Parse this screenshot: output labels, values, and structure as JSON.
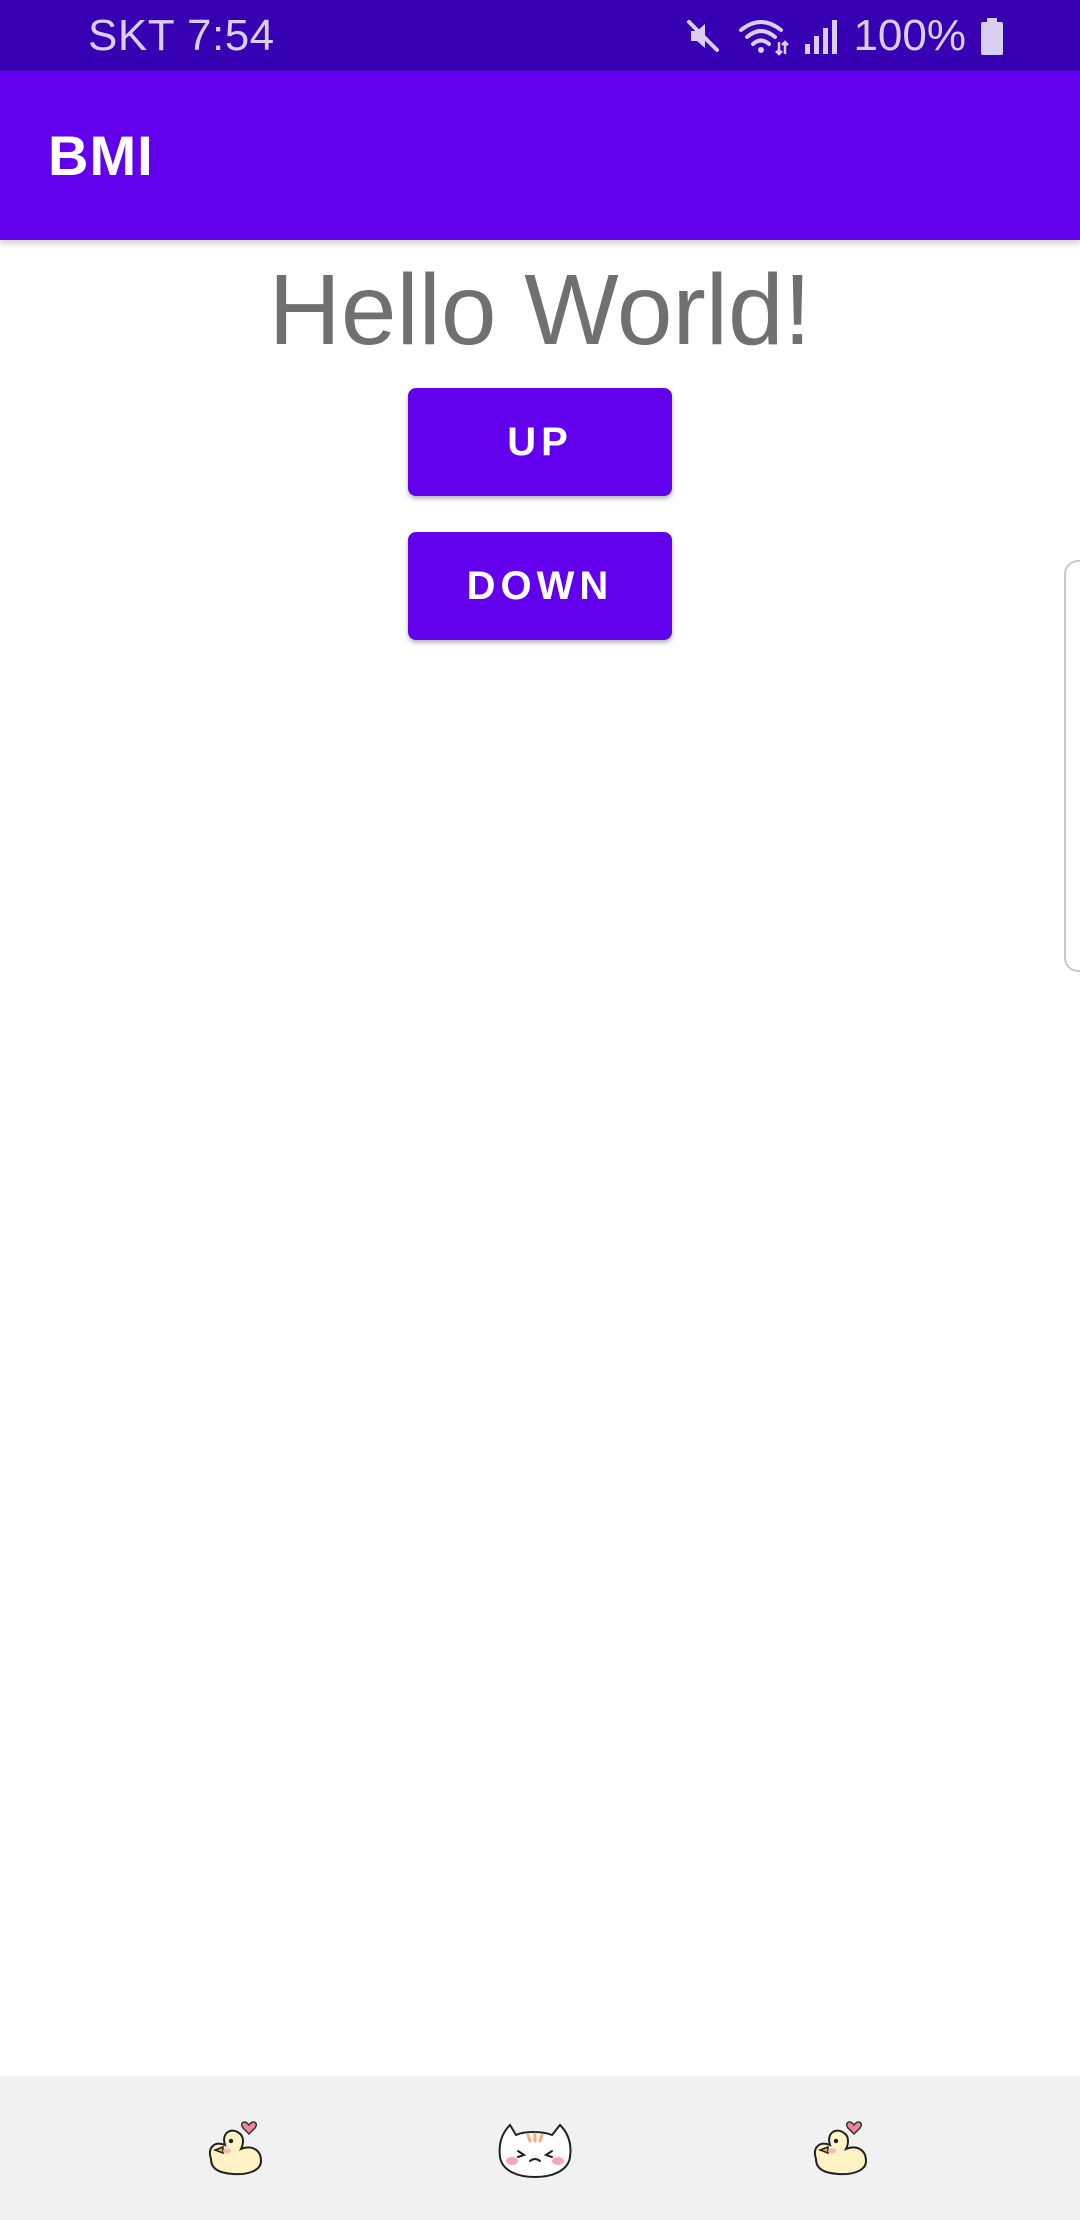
{
  "status_bar": {
    "carrier_time": "SKT 7:54",
    "battery": "100%",
    "icons": [
      "mute-icon",
      "wifi-icon",
      "signal-icon",
      "battery-icon"
    ],
    "background_color": "#3700b3"
  },
  "app_bar": {
    "title": "BMI",
    "background_color": "#6200ee"
  },
  "main": {
    "hello_text": "Hello World!",
    "up_button_label": "UP",
    "down_button_label": "DOWN"
  },
  "edge_panel": {
    "icon": "edge-panel-handle"
  },
  "nav_bar": {
    "items": [
      {
        "icon": "duck-icon"
      },
      {
        "icon": "cat-icon"
      },
      {
        "icon": "duck-icon"
      }
    ],
    "background_color": "#f1f1f1"
  }
}
